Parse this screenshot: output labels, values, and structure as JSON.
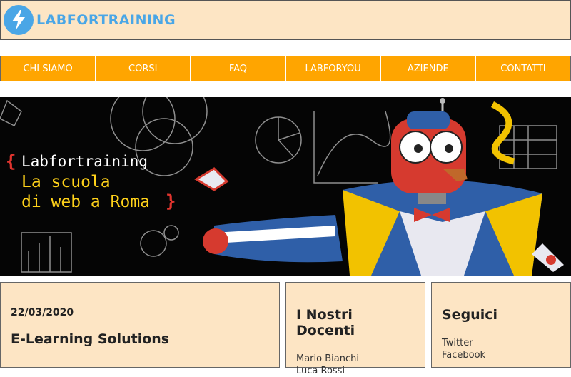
{
  "header": {
    "logo_text": "LABFORTRAINING",
    "colors": {
      "brand_blue": "#4aa6e6",
      "header_bg": "#fde5c4"
    }
  },
  "nav": {
    "accent": "#ffa500",
    "items": [
      {
        "label": "CHI SIAMO"
      },
      {
        "label": "CORSI"
      },
      {
        "label": "FAQ"
      },
      {
        "label": "LABFORYOU"
      },
      {
        "label": "AZIENDE"
      },
      {
        "label": "CONTATTI"
      }
    ]
  },
  "hero": {
    "title": "Labfortraining",
    "line1": "La scuola",
    "line2": "di web a Roma",
    "bracket_open": "{",
    "bracket_close": "}"
  },
  "main_card": {
    "date": "22/03/2020",
    "title": "E-Learning Solutions"
  },
  "docenti": {
    "title": "I Nostri Docenti",
    "items": [
      "Mario Bianchi",
      "Luca Rossi"
    ]
  },
  "seguici": {
    "title": "Seguici",
    "items": [
      "Twitter",
      "Facebook"
    ]
  }
}
